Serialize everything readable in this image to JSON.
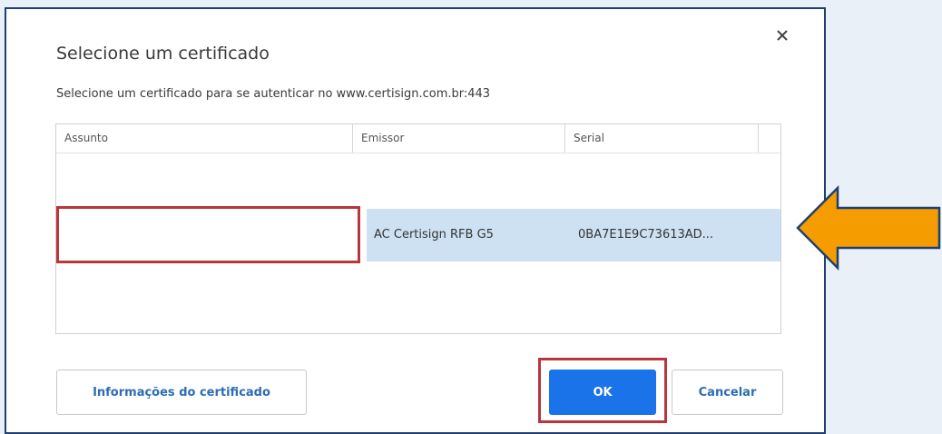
{
  "dialog": {
    "title": "Selecione um certificado",
    "subtitle": "Selecione um certificado para se autenticar no www.certisign.com.br:443",
    "close_glyph": "×"
  },
  "table": {
    "columns": [
      "Assunto",
      "Emissor",
      "Serial"
    ],
    "rows": [
      {
        "subject": "",
        "issuer": "AC Certisign RFB G5",
        "serial": "0BA7E1E9C73613AD..."
      }
    ]
  },
  "buttons": {
    "info": "Informações do certificado",
    "ok": "OK",
    "cancel": "Cancelar"
  },
  "colors": {
    "background": "#e9f0f8",
    "frame_border": "#1f3f73",
    "selected_row": "#cde1f3",
    "highlight": "#b8363c",
    "primary_button": "#1a73e8",
    "arrow_fill": "#f59c00",
    "arrow_stroke": "#1f3f73"
  },
  "icons": {
    "close": "close-icon",
    "pointer": "arrow-left-icon"
  }
}
